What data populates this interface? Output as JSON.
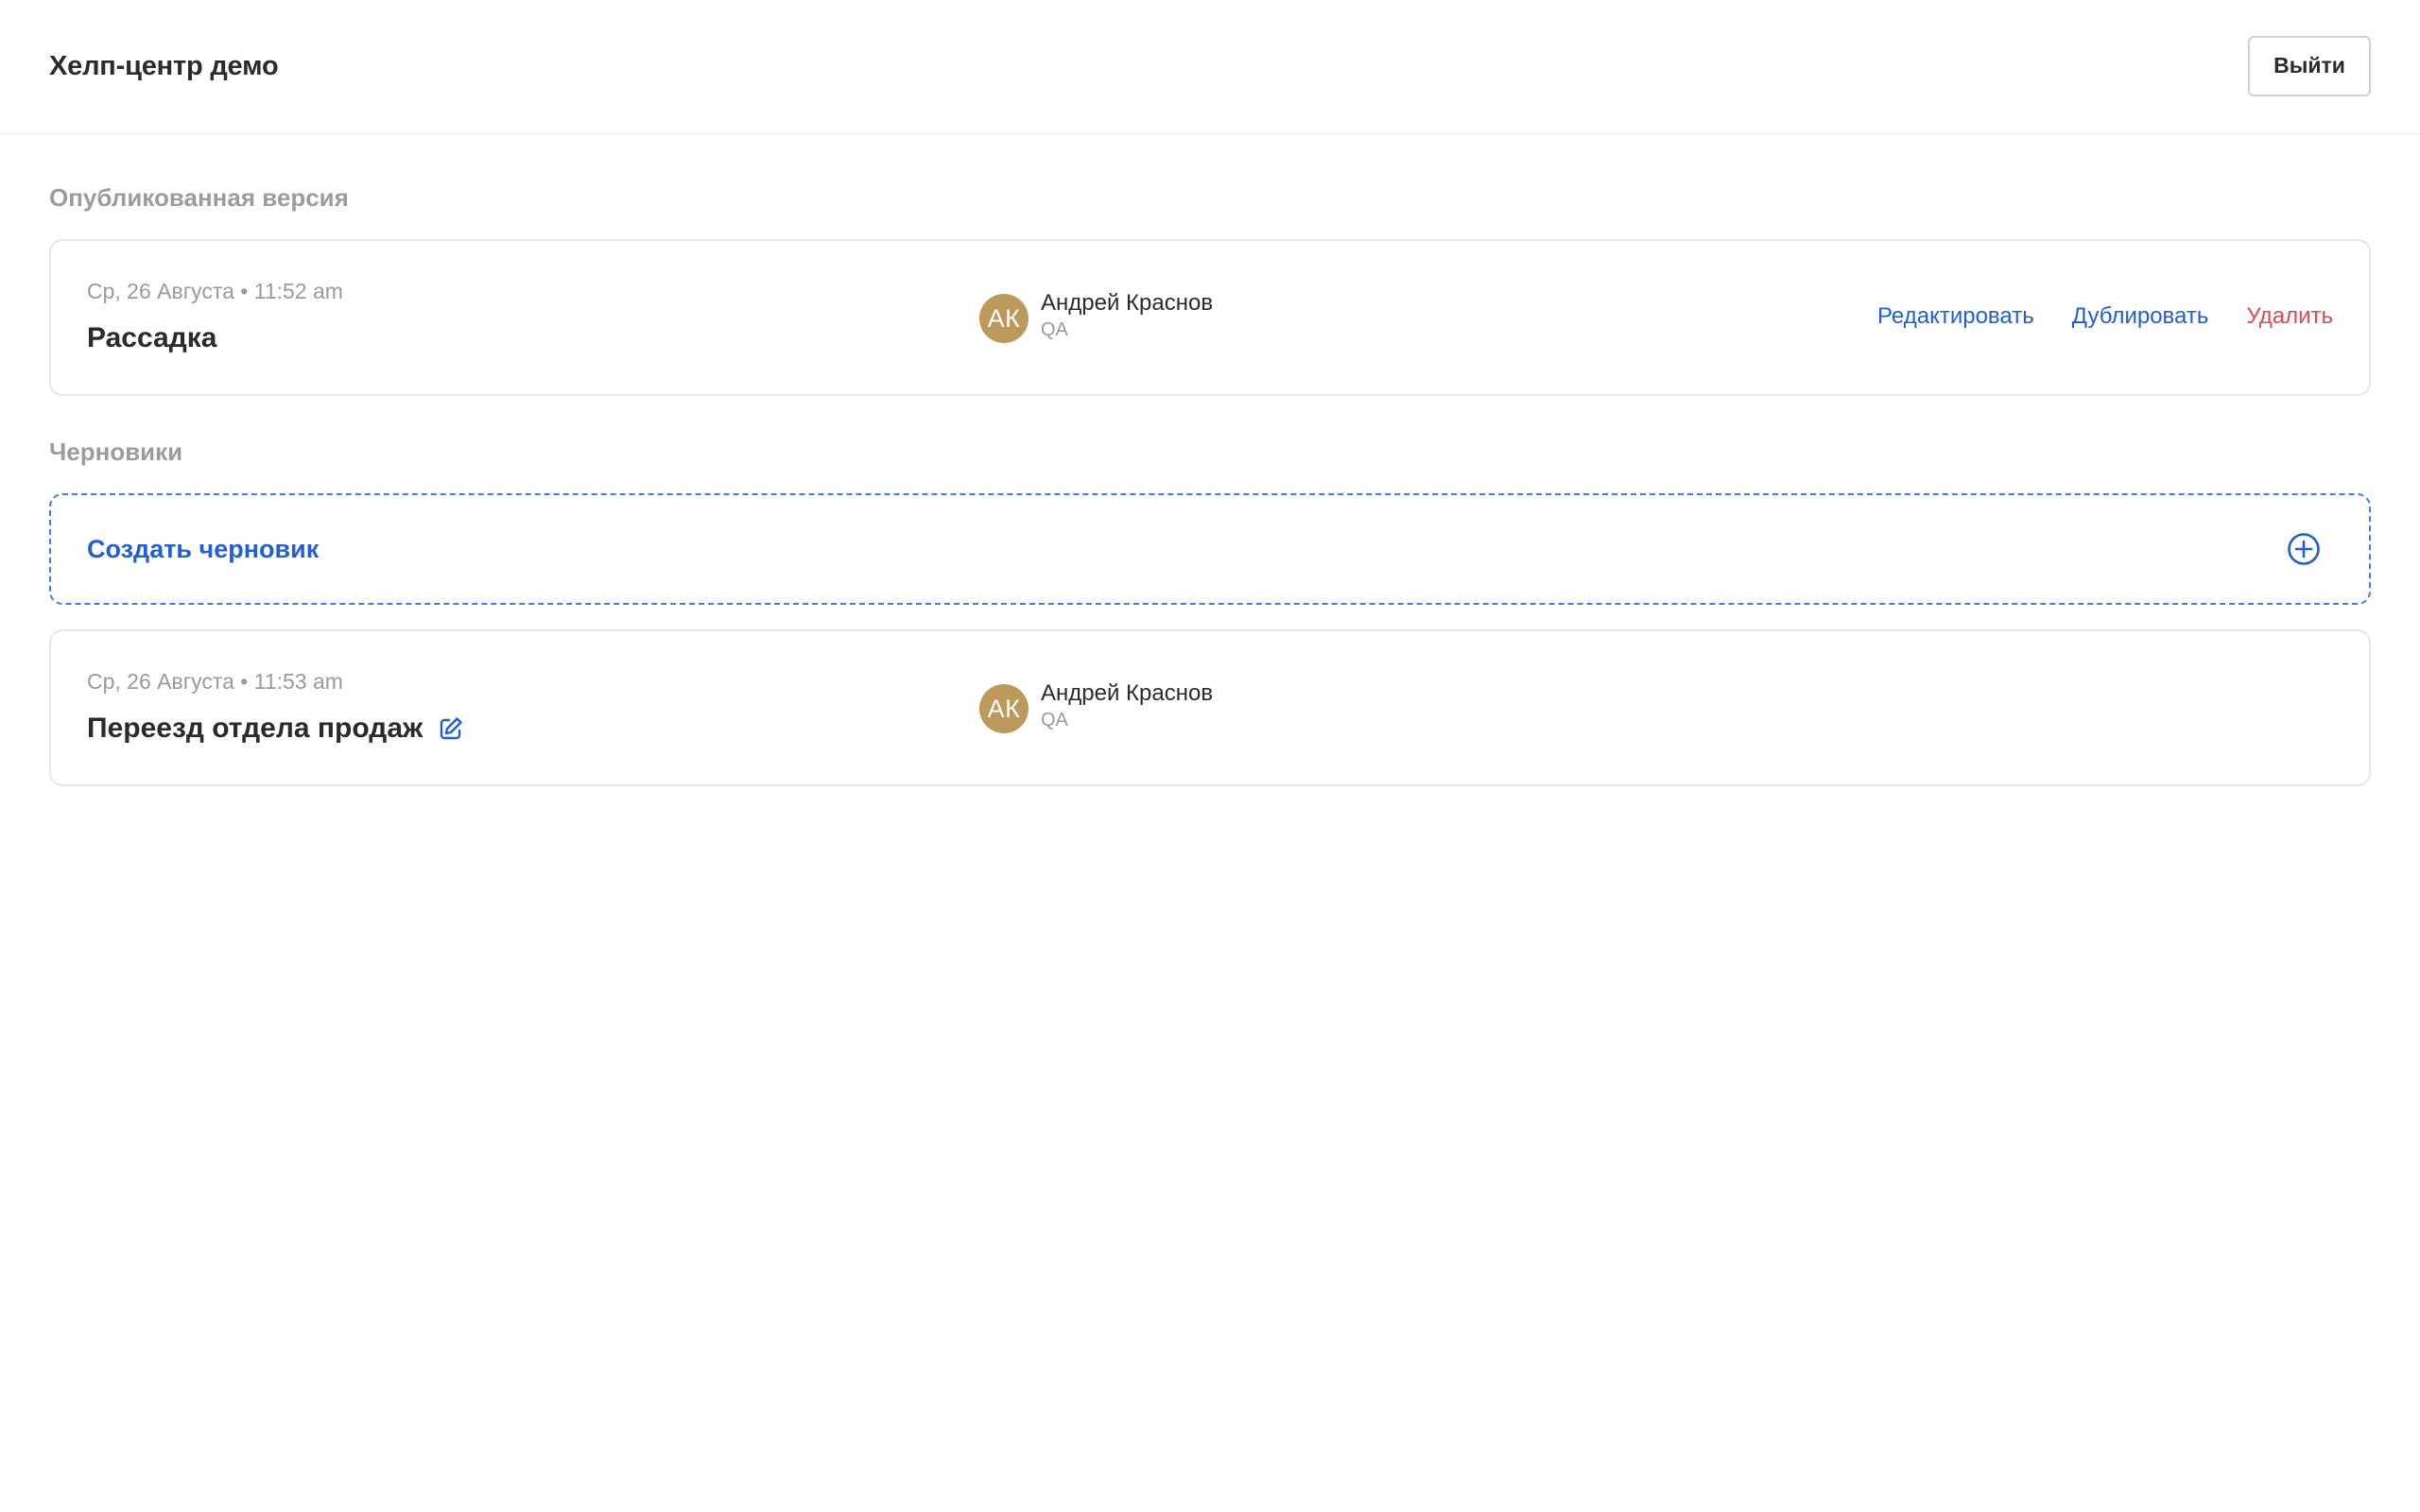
{
  "header": {
    "title": "Хелп-центр демо",
    "logout_label": "Выйти"
  },
  "published": {
    "section_title": "Опубликованная версия",
    "card": {
      "date": "Ср, 26 Августа • 11:52 am",
      "title": "Рассадка",
      "author": {
        "initials": "АК",
        "name": "Андрей Краснов",
        "role": "QA"
      },
      "actions": {
        "edit": "Редактировать",
        "duplicate": "Дублировать",
        "delete": "Удалить"
      }
    }
  },
  "drafts": {
    "section_title": "Черновики",
    "create_label": "Создать черновик",
    "items": [
      {
        "date": "Ср, 26 Августа • 11:53 am",
        "title": "Переезд отдела продаж",
        "author": {
          "initials": "АК",
          "name": "Андрей Краснов",
          "role": "QA"
        }
      }
    ]
  },
  "icons": {
    "create": "plus-circle-icon",
    "edit_title": "edit-pencil-icon"
  },
  "colors": {
    "accent": "#1f5fdd",
    "danger": "#e5484d",
    "avatar": "#bd9a5c",
    "muted": "#9a9a9a"
  }
}
